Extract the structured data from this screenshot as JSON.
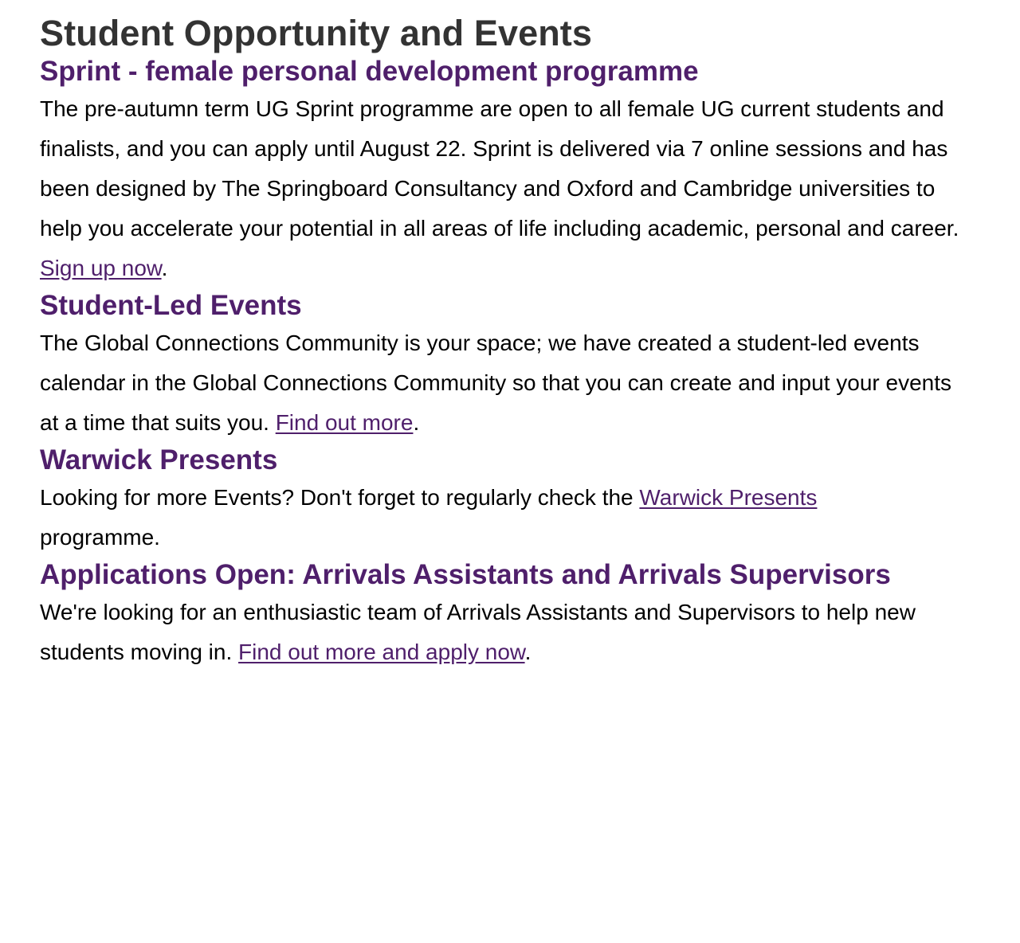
{
  "page": {
    "title": "Student Opportunity and Events"
  },
  "colors": {
    "heading": "#4f1f6b",
    "title": "#333333",
    "link": "#4f1f6b",
    "body_text": "#000000"
  },
  "sections": [
    {
      "heading": "Sprint - female personal development programme",
      "body": "The pre-autumn term UG Sprint programme are open to all female UG current students and finalists, and you can apply until August 22. Sprint is delivered via 7 online sessions and has been designed by The Springboard Consultancy and Oxford and Cambridge universities to help you accelerate your potential in all areas of life including academic, personal and career. ",
      "link_text": "Sign up now",
      "after_link": "."
    },
    {
      "heading": "Student-Led Events",
      "body": "The Global Connections Community is your space; we have created a student-led events calendar in the Global Connections Community so that you can create and input your events at a time that suits you. ",
      "link_text": "Find out more",
      "after_link": "."
    },
    {
      "heading": "Warwick Presents",
      "body": "Looking for more Events? Don't forget to regularly check the ",
      "link_text": "Warwick Presents",
      "after_link": " programme."
    },
    {
      "heading": "Applications Open: Arrivals Assistants and Arrivals Supervisors",
      "body": "We're looking for an enthusiastic team of Arrivals Assistants and Supervisors to help new students moving in. ",
      "link_text": "Find out more and apply now",
      "after_link": "."
    }
  ]
}
